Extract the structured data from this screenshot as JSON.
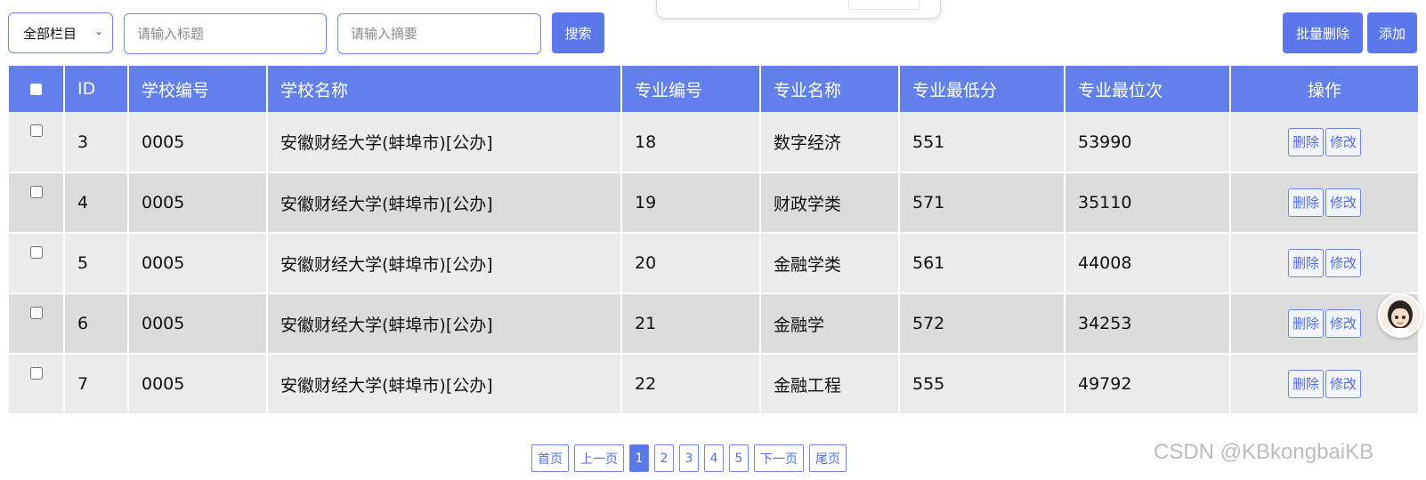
{
  "toolbar": {
    "category_select": "全部栏目",
    "title_placeholder": "请输入标题",
    "summary_placeholder": "请输入摘要",
    "search_label": "搜索",
    "batch_delete_label": "批量删除",
    "add_label": "添加"
  },
  "table": {
    "headers": [
      "ID",
      "学校编号",
      "学校名称",
      "专业编号",
      "专业名称",
      "专业最低分",
      "专业最位次",
      "操作"
    ],
    "rows": [
      {
        "id": "3",
        "school_no": "0005",
        "school_name": "安徽财经大学(蚌埠市)[公办]",
        "major_no": "18",
        "major_name": "数字经济",
        "min_score": "551",
        "min_rank": "53990"
      },
      {
        "id": "4",
        "school_no": "0005",
        "school_name": "安徽财经大学(蚌埠市)[公办]",
        "major_no": "19",
        "major_name": "财政学类",
        "min_score": "571",
        "min_rank": "35110"
      },
      {
        "id": "5",
        "school_no": "0005",
        "school_name": "安徽财经大学(蚌埠市)[公办]",
        "major_no": "20",
        "major_name": "金融学类",
        "min_score": "561",
        "min_rank": "44008"
      },
      {
        "id": "6",
        "school_no": "0005",
        "school_name": "安徽财经大学(蚌埠市)[公办]",
        "major_no": "21",
        "major_name": "金融学",
        "min_score": "572",
        "min_rank": "34253"
      },
      {
        "id": "7",
        "school_no": "0005",
        "school_name": "安徽财经大学(蚌埠市)[公办]",
        "major_no": "22",
        "major_name": "金融工程",
        "min_score": "555",
        "min_rank": "49792"
      }
    ],
    "delete_label": "删除",
    "edit_label": "修改"
  },
  "pagination": {
    "first": "首页",
    "prev": "上一页",
    "pages": [
      "1",
      "2",
      "3",
      "4",
      "5"
    ],
    "current": "1",
    "next": "下一页",
    "last": "尾页"
  },
  "watermark": "CSDN @KBkongbaiKB",
  "colors": {
    "primary": "#5b78ea",
    "header_bg": "#6280ec",
    "row_odd": "#ebebeb",
    "row_even": "#dcdcdc"
  }
}
